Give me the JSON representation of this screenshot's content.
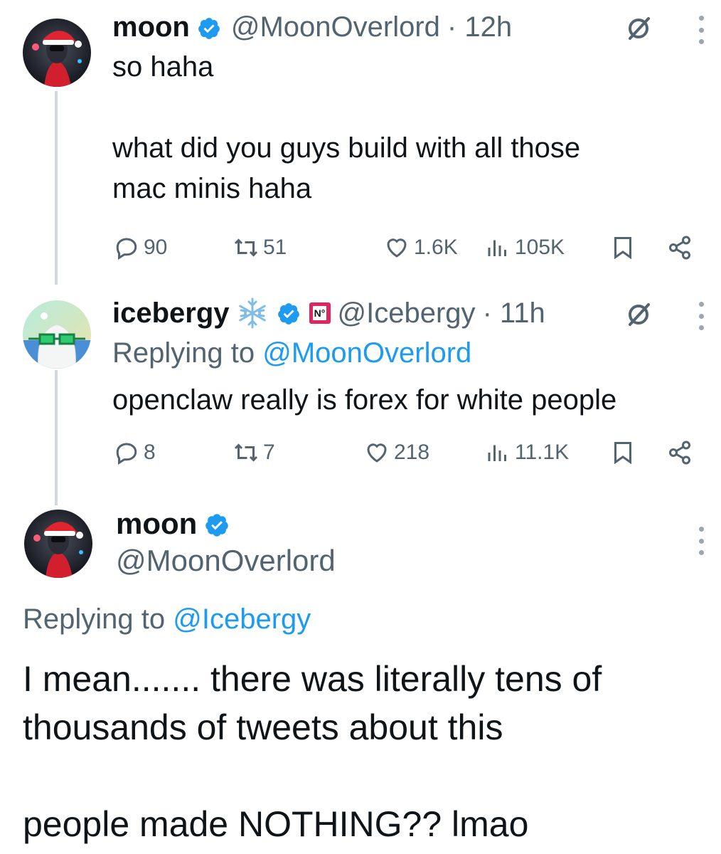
{
  "tweets": [
    {
      "name": "moon",
      "handle": "@MoonOverlord",
      "time": "· 12h",
      "text": "so haha\n\nwhat did you guys build with all those\nmac minis haha",
      "stats": {
        "replies": "90",
        "retweets": "51",
        "likes": "1.6K",
        "views": "105K"
      }
    },
    {
      "name": "icebergy",
      "handle": "@Icebergy",
      "time": "· 11h",
      "replying_prefix": "Replying to ",
      "replying_to": "@MoonOverlord",
      "badge_text": "N°",
      "text": "openclaw really is forex for white people",
      "stats": {
        "replies": "8",
        "retweets": "7",
        "likes": "218",
        "views": "11.1K"
      }
    },
    {
      "name": "moon",
      "handle": "@MoonOverlord",
      "replying_prefix": "Replying to ",
      "replying_to": "@Icebergy",
      "text": "I mean....... there was literally tens of\nthousands of tweets about this\n\npeople made NOTHING?? lmao"
    }
  ],
  "icons": {
    "verified": "verified-badge-icon",
    "grok": "grok-icon",
    "more": "more-options-icon",
    "reply": "reply-icon",
    "retweet": "retweet-icon",
    "like": "like-icon",
    "views": "views-icon",
    "bookmark": "bookmark-icon",
    "share": "share-icon",
    "snowflake": "snowflake-icon"
  },
  "colors": {
    "accent": "#1d9bf0",
    "text": "#0f1419",
    "secondary": "#536471",
    "thread_line": "#cfd9de"
  }
}
